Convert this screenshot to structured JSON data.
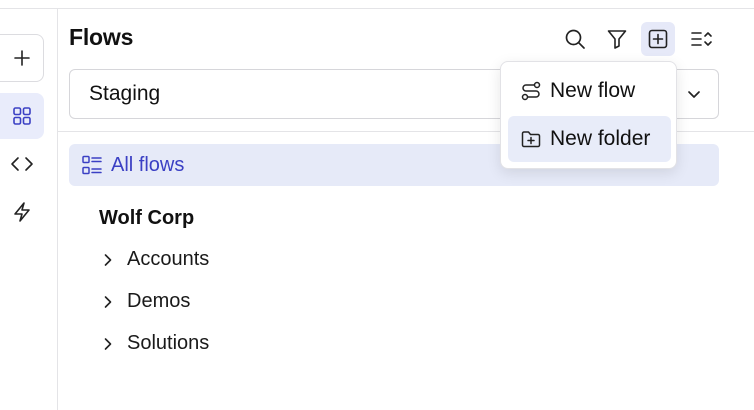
{
  "rail": {
    "items": [
      {
        "name": "add",
        "icon": "plus-icon"
      },
      {
        "name": "flows",
        "icon": "grid-icon",
        "active": true
      },
      {
        "name": "code",
        "icon": "code-icon"
      },
      {
        "name": "triggers",
        "icon": "bolt-icon"
      }
    ]
  },
  "panel": {
    "title": "Flows",
    "toolbar": [
      "search-icon",
      "filter-icon",
      "add-square-icon",
      "sort-list-icon"
    ]
  },
  "environment": {
    "selected": "Staging"
  },
  "nav": {
    "all_flows_label": "All flows"
  },
  "tree": {
    "group_title": "Wolf Corp",
    "folders": [
      {
        "label": "Accounts"
      },
      {
        "label": "Demos"
      },
      {
        "label": "Solutions"
      }
    ]
  },
  "menu": {
    "items": [
      {
        "label": "New flow",
        "icon": "flow-icon"
      },
      {
        "label": "New folder",
        "icon": "folder-plus-icon"
      }
    ]
  },
  "colors": {
    "accent": "#3b40c4",
    "active_bg": "#e6eaf8",
    "border": "#e4e4e7"
  }
}
